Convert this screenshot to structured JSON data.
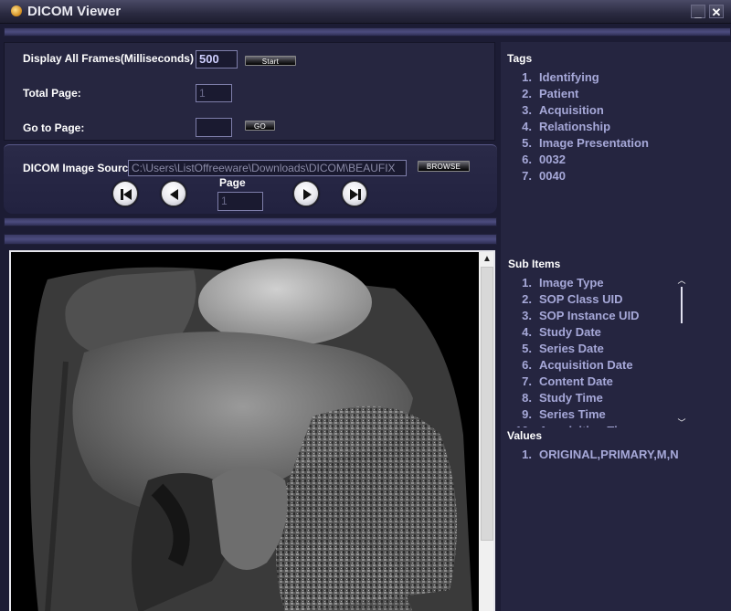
{
  "window": {
    "title": "DICOM Viewer",
    "minimize": "_",
    "close": "✕"
  },
  "playback": {
    "frames_label": "Display All Frames(Milliseconds)",
    "frames_value": "500",
    "start_label": "Start",
    "total_page_label": "Total Page:",
    "total_page_value": "1",
    "goto_label": "Go to Page:",
    "goto_value": "",
    "go_label": "GO"
  },
  "source": {
    "label": "DICOM Image Source",
    "path": "C:\\Users\\ListOffreeware\\Downloads\\DICOM\\BEAUFIX",
    "browse_label": "BROWSE",
    "page_label": "Page",
    "page_value": "1"
  },
  "nav_icons": [
    "first-page-icon",
    "previous-page-icon",
    "next-page-icon",
    "last-page-icon"
  ],
  "tags": {
    "title": "Tags",
    "items": [
      "Identifying",
      "Patient",
      "Acquisition",
      "Relationship",
      "Image Presentation",
      "0032",
      "0040"
    ]
  },
  "sub_items": {
    "title": "Sub Items",
    "items": [
      "Image Type",
      "SOP Class UID",
      "SOP Instance UID",
      "Study Date",
      "Series Date",
      "Acquisition Date",
      "Content Date",
      "Study Time",
      "Series Time",
      "Acquisition Time"
    ]
  },
  "values": {
    "title": "Values",
    "items": [
      "ORIGINAL,PRIMARY,M,NORM"
    ]
  },
  "colors": {
    "background": "#1c1c34",
    "panel": "#262640",
    "list_text": "#a6a8d8",
    "field_border": "#7e7eaa"
  }
}
